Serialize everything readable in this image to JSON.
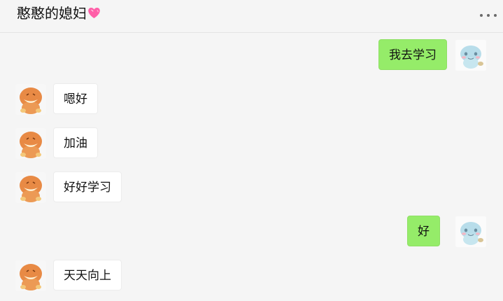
{
  "chat": {
    "title": "憨憨的媳妇",
    "title_emoji": "heart-icon",
    "more_icon": "more-icon",
    "messages": [
      {
        "side": "right",
        "text": "我去学习"
      },
      {
        "side": "left",
        "text": "嗯好"
      },
      {
        "side": "left",
        "text": "加油"
      },
      {
        "side": "left",
        "text": "好好学习"
      },
      {
        "side": "right",
        "text": "好"
      },
      {
        "side": "left",
        "text": "天天向上"
      }
    ]
  },
  "colors": {
    "background": "#f5f5f5",
    "outgoing_bubble": "#95ec69",
    "incoming_bubble": "#ffffff",
    "heart": "#ff5fa8"
  }
}
